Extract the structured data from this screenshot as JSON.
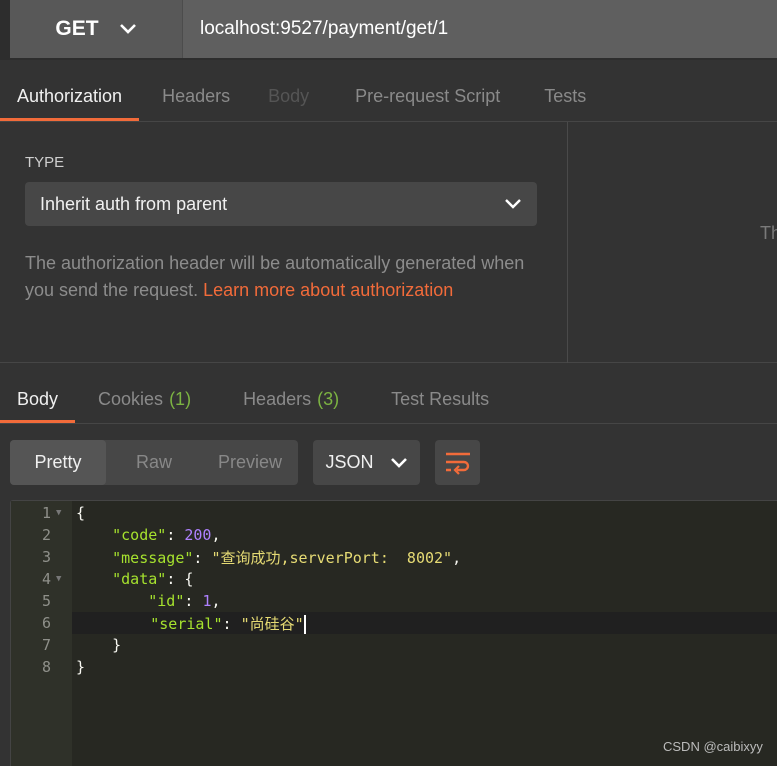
{
  "request": {
    "method": "GET",
    "url": "localhost:9527/payment/get/1"
  },
  "req_tabs": [
    {
      "label": "Authorization",
      "state": "active"
    },
    {
      "label": "Headers"
    },
    {
      "label": "Body",
      "state": "disabled"
    },
    {
      "label": "Pre-request Script"
    },
    {
      "label": "Tests"
    }
  ],
  "auth": {
    "type_label": "TYPE",
    "type_value": "Inherit auth from parent",
    "desc": "The authorization header will be automatically generated when you send the request. ",
    "link": "Learn more about authorization",
    "right_text": "Th"
  },
  "res_tabs": [
    {
      "label": "Body",
      "state": "active"
    },
    {
      "label": "Cookies",
      "count": "(1)"
    },
    {
      "label": "Headers",
      "count": "(3)"
    },
    {
      "label": "Test Results"
    }
  ],
  "view_modes": [
    "Pretty",
    "Raw",
    "Preview"
  ],
  "format": "JSON",
  "colors": {
    "accent": "#f26b3a",
    "count_green": "#7cb342",
    "editor_bg": "#272822"
  },
  "code_lines": [
    "1",
    "2",
    "3",
    "4",
    "5",
    "6",
    "7",
    "8"
  ],
  "json": {
    "code_key": "\"code\"",
    "code_val": "200",
    "message_key": "\"message\"",
    "message_val": "\"查询成功,serverPort:  8002\"",
    "data_key": "\"data\"",
    "id_key": "\"id\"",
    "id_val": "1",
    "serial_key": "\"serial\"",
    "serial_val": "\"尚硅谷\""
  },
  "watermark": "CSDN @caibixyy"
}
